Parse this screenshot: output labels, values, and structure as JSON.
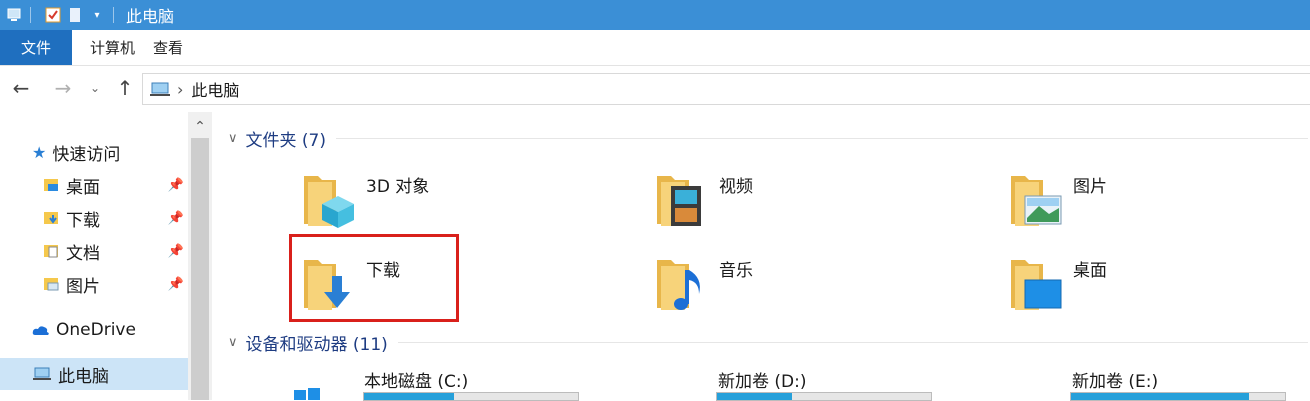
{
  "window": {
    "title": "此电脑"
  },
  "ribbon": {
    "tabs": [
      "文件",
      "计算机",
      "查看"
    ]
  },
  "address": {
    "path": "此电脑"
  },
  "sidebar": {
    "items": [
      {
        "label": "快速访问",
        "icon": "star-icon"
      },
      {
        "label": "桌面",
        "icon": "desktop-folder-icon",
        "pinned": true
      },
      {
        "label": "下载",
        "icon": "download-folder-icon",
        "pinned": true
      },
      {
        "label": "文档",
        "icon": "documents-folder-icon",
        "pinned": true
      },
      {
        "label": "图片",
        "icon": "pictures-folder-icon",
        "pinned": true
      },
      {
        "label": "OneDrive",
        "icon": "cloud-icon"
      },
      {
        "label": "此电脑",
        "icon": "computer-icon",
        "selected": true
      }
    ]
  },
  "folders": {
    "header": "文件夹 (7)",
    "items": [
      {
        "label": "3D 对象",
        "icon": "3d-objects-folder-icon"
      },
      {
        "label": "视频",
        "icon": "videos-folder-icon"
      },
      {
        "label": "图片",
        "icon": "pictures-folder-icon"
      },
      {
        "label": "下载",
        "icon": "downloads-folder-icon",
        "highlighted": true
      },
      {
        "label": "音乐",
        "icon": "music-folder-icon"
      },
      {
        "label": "桌面",
        "icon": "desktop-folder-icon"
      }
    ]
  },
  "devices": {
    "header": "设备和驱动器 (11)",
    "items": [
      {
        "label": "本地磁盘 (C:)",
        "usage": 0.42
      },
      {
        "label": "新加卷 (D:)",
        "usage": 0.35
      },
      {
        "label": "新加卷 (E:)",
        "usage": 0.83
      }
    ]
  },
  "colors": {
    "titlebar": "#3b8fd6",
    "file_tab": "#1f6fbf",
    "highlight": "#d9201b",
    "drive_fill": "#26a0da"
  }
}
